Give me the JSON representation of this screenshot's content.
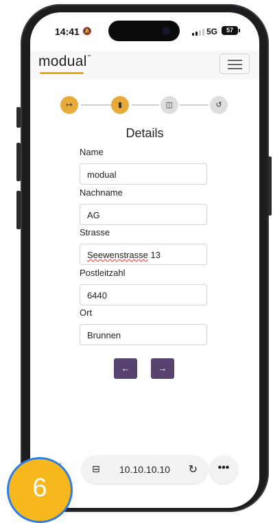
{
  "status_bar": {
    "time": "14:41",
    "network": "5G",
    "battery": "57"
  },
  "navbar": {
    "logo": "modual",
    "logo_tm": "™",
    "accent_color": "#e9a900"
  },
  "stepper": {
    "steps": [
      {
        "icon": "sign-in-icon",
        "glyph": "↦",
        "state": "active"
      },
      {
        "icon": "document-icon",
        "glyph": "▮",
        "state": "active"
      },
      {
        "icon": "clipboard-check-icon",
        "glyph": "◫",
        "state": "inactive"
      },
      {
        "icon": "undo-icon",
        "glyph": "↺",
        "state": "inactive"
      }
    ],
    "active_color": "#e6ab38"
  },
  "form": {
    "title": "Details",
    "fields": [
      {
        "label": "Name",
        "value": "modual"
      },
      {
        "label": "Nachname",
        "value": "AG"
      },
      {
        "label": "Strasse",
        "value_main": "Seewenstrasse",
        "value_rest": " 13"
      },
      {
        "label": "Postleitzahl",
        "value": "6440"
      },
      {
        "label": "Ort",
        "value": "Brunnen"
      }
    ],
    "back_button": "←",
    "next_button": "→",
    "button_color": "#584270"
  },
  "browser": {
    "url": "10.10.10.10",
    "tabs_icon": "⊟",
    "reload_icon": "↻",
    "more_icon": "•••",
    "back_icon": "‹"
  },
  "badge": {
    "number": "6"
  }
}
